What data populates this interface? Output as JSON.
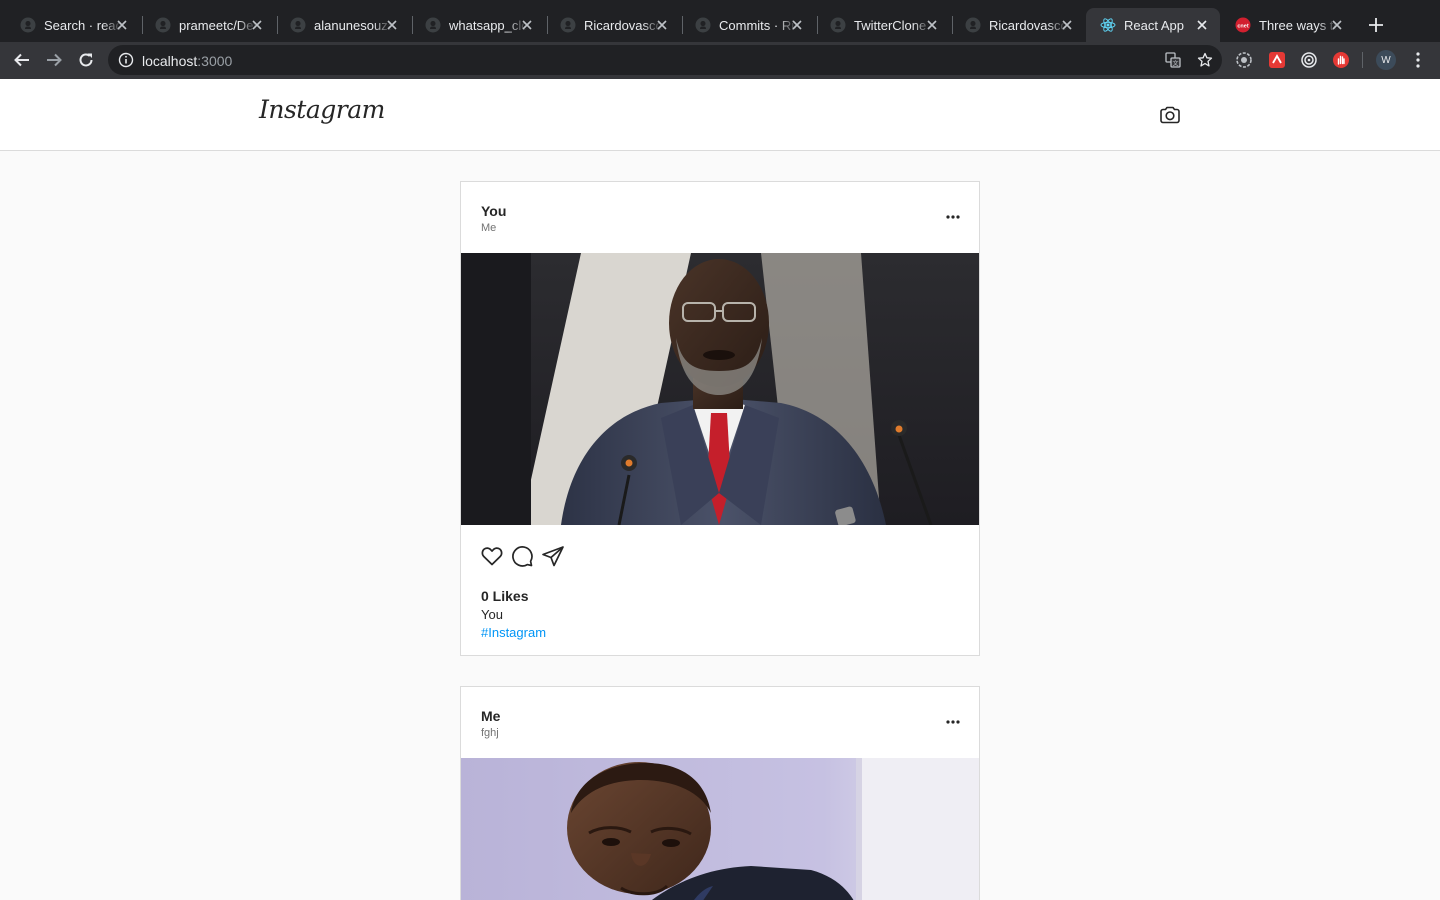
{
  "browser": {
    "tabs": [
      {
        "title": "Search · react-instagram",
        "icon": "github-icon"
      },
      {
        "title": "prameetc/Dev",
        "icon": "github-icon"
      },
      {
        "title": "alanunesouza",
        "icon": "github-icon"
      },
      {
        "title": "whatsapp_clone",
        "icon": "github-icon"
      },
      {
        "title": "Ricardovasconcelos",
        "icon": "github-icon"
      },
      {
        "title": "Commits · Ricardo",
        "icon": "github-icon"
      },
      {
        "title": "TwitterClone",
        "icon": "github-icon"
      },
      {
        "title": "Ricardovasconcelos",
        "icon": "github-icon"
      },
      {
        "title": "React App",
        "icon": "react-icon",
        "active": true
      },
      {
        "title": "Three ways to",
        "icon": "cnet-icon"
      }
    ],
    "url_host": "localhost",
    "url_port": ":3000",
    "profile_initial": "W"
  },
  "app": {
    "logo": "Instagram"
  },
  "posts": [
    {
      "username": "You",
      "location": "Me",
      "likes": "0 Likes",
      "caption_user": "You",
      "hashtag": "#Instagram"
    },
    {
      "username": "Me",
      "location": "fghj"
    }
  ],
  "colors": {
    "tab_strip": "#202124",
    "toolbar": "#35363a",
    "hashtag": "#0095f6",
    "page_bg": "#fafafa"
  }
}
